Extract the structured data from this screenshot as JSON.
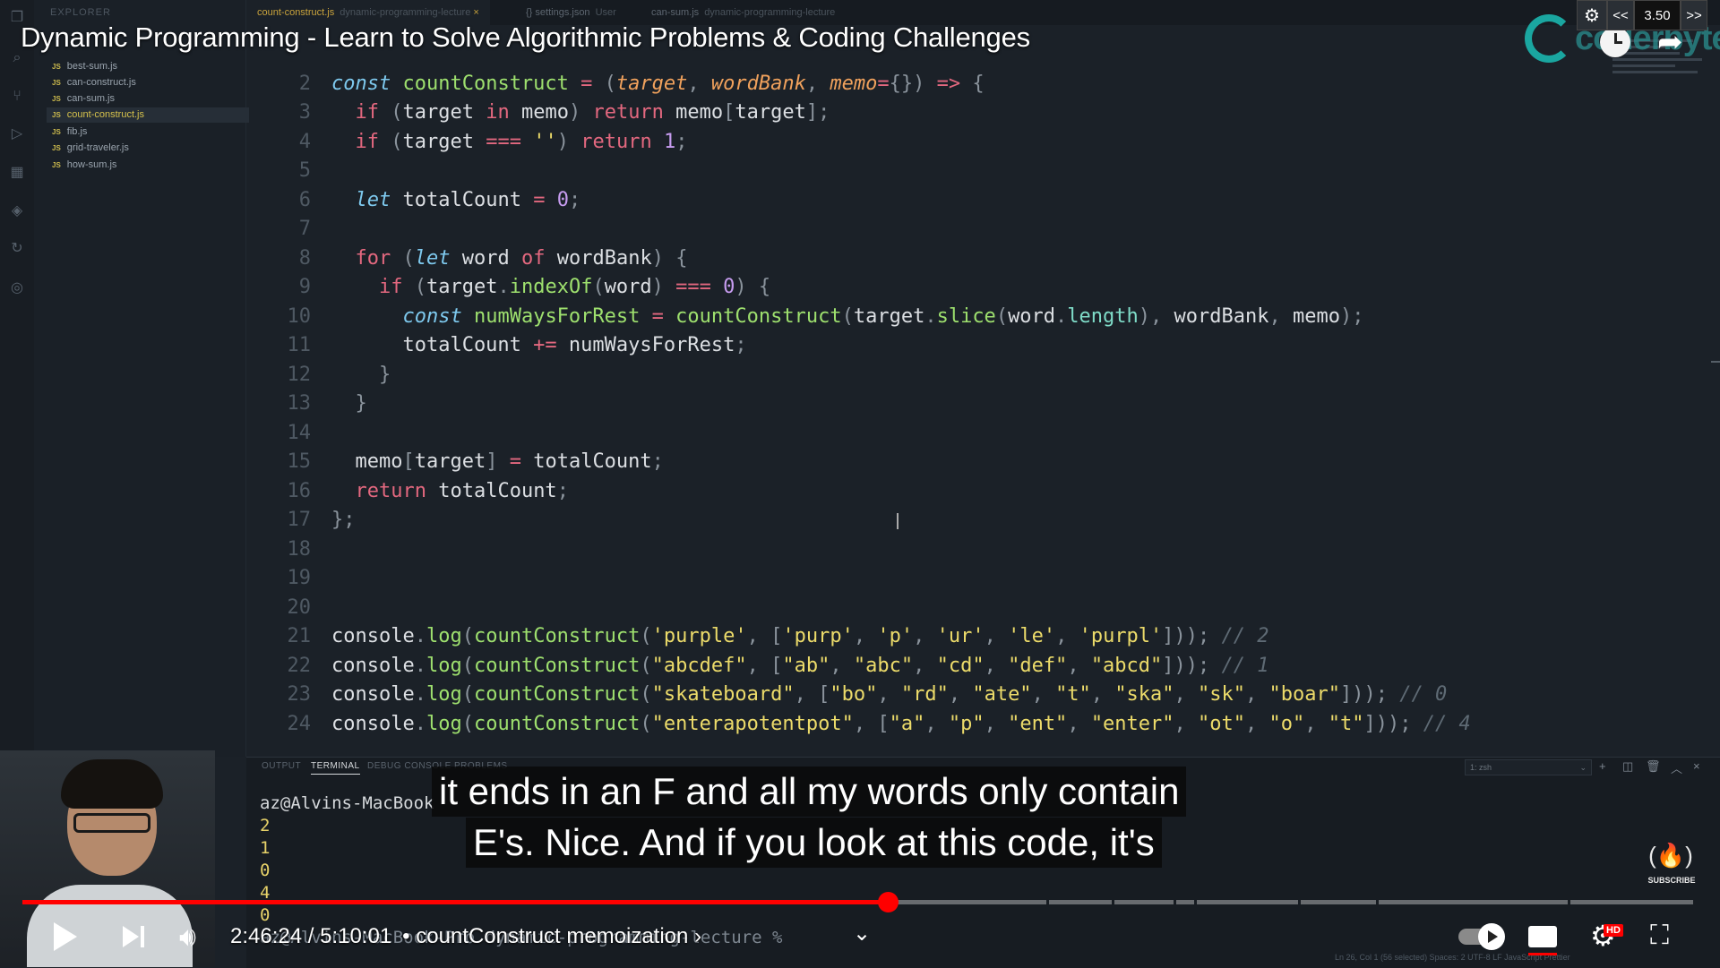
{
  "video": {
    "title": "Dynamic Programming - Learn to Solve Algorithmic Problems & Coding Challenges",
    "channel_logo_text": "coderbyte",
    "speed": {
      "value": "3.50",
      "down_label": "<<",
      "up_label": ">>"
    },
    "captions": [
      "it ends in an F and all my words only contain",
      "E's. Nice. And if you look at this code, it's"
    ],
    "time_current": "2:46:24",
    "time_total": "5:10:01",
    "chapter": "• countConstruct memoization",
    "chapter_arrow": "›",
    "progress_fraction": 0.518,
    "subscribe_label": "SUBSCRIBE",
    "hd_label": "HD",
    "colors": {
      "progress": "#ff0000",
      "accent_teal": "#1aa6a0"
    }
  },
  "editor": {
    "explorer_label": "EXPLORER",
    "files": [
      "best-sum.js",
      "can-construct.js",
      "can-sum.js",
      "count-construct.js",
      "fib.js",
      "grid-traveler.js",
      "how-sum.js"
    ],
    "active_file": "count-construct.js",
    "file_type_label": "JS",
    "tabs": [
      {
        "label": "count-construct.js",
        "desc": "dynamic-programming-lecture",
        "close": "×"
      },
      {
        "label": "{} settings.json",
        "desc": "User"
      },
      {
        "label": "can-sum.js",
        "desc": "dynamic-programming-lecture"
      }
    ],
    "line_numbers": [
      "2",
      "3",
      "4",
      "5",
      "6",
      "7",
      "8",
      "9",
      "10",
      "11",
      "12",
      "13",
      "14",
      "15",
      "16",
      "17",
      "18",
      "19",
      "20",
      "21",
      "22",
      "23",
      "24"
    ]
  },
  "terminal": {
    "tabs": [
      "OUTPUT",
      "TERMINAL",
      "DEBUG CONSOLE",
      "PROBLEMS"
    ],
    "active_tab": "TERMINAL",
    "shell_select": "1: zsh",
    "prompt": "az@Alvins-MacBook",
    "outputs": [
      "2",
      "1",
      "0",
      "4",
      "0"
    ],
    "last_prompt": "az@Alvins-MacBook-Pro dynamic-programming-lecture %"
  },
  "statusbar": "Ln 26, Col 1 (56 selected)   Spaces: 2   UTF-8   LF   JavaScript   Prettier"
}
